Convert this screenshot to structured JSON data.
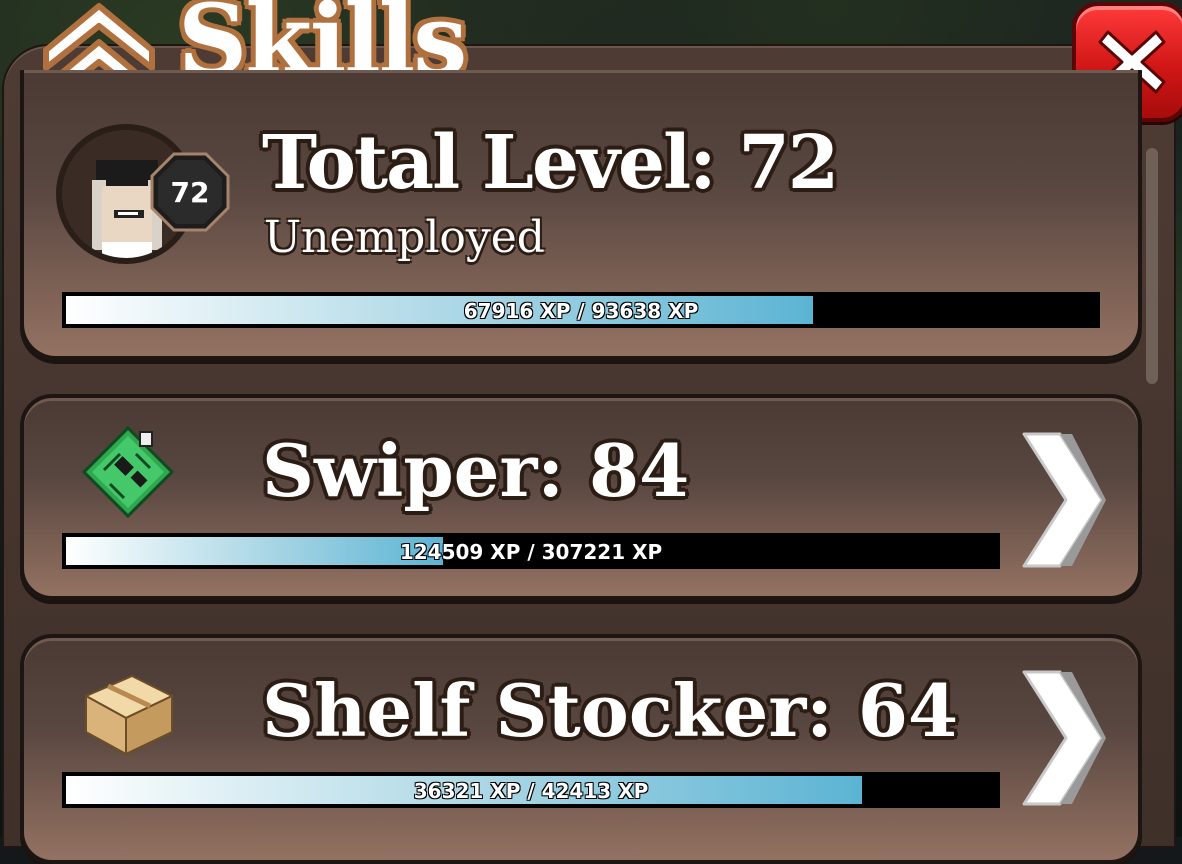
{
  "window": {
    "title": "Skills",
    "close_label": "close"
  },
  "colors": {
    "panel": "#4e3c34",
    "card_bottom": "#947262",
    "close_red": "#d01616",
    "title_outline": "#b0713f",
    "xp_fill_end": "#5bb4d4"
  },
  "total": {
    "heading": "Total Level: 72",
    "job": "Unemployed",
    "badge_level": "72",
    "xp_text": "67916 XP / 93638 XP",
    "xp_current": 67916,
    "xp_max": 93638
  },
  "skills": [
    {
      "icon": "circuit-board-icon",
      "heading": "Swiper: 84",
      "xp_text": "124509 XP / 307221 XP",
      "xp_current": 124509,
      "xp_max": 307221
    },
    {
      "icon": "cardboard-box-icon",
      "heading": "Shelf Stocker: 64",
      "xp_text": "36321 XP / 42413 XP",
      "xp_current": 36321,
      "xp_max": 42413
    }
  ]
}
